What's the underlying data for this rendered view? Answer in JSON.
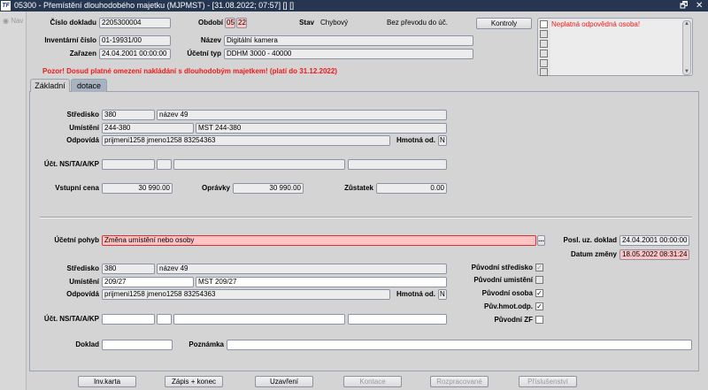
{
  "window": {
    "title": "05300 - Přemístění dlouhodobého majetku (MJPMST) - [31.08.2022; 07:57] [] []",
    "logo": "TF",
    "restore": "🗗",
    "close": "✕"
  },
  "sidebar": {
    "nav_label": "Nav"
  },
  "header": {
    "cislo_dokladu_label": "Číslo dokladu",
    "cislo_dokladu": "2205300004",
    "obdobi_label": "Období",
    "obdobi_month": "05",
    "obdobi_year": "22",
    "stav_label": "Stav",
    "stav": "Chybový",
    "bez_prevodu": "Bez převodu do úč.",
    "kontroly_label": "Kontroly",
    "inventarni_cislo_label": "Inventární číslo",
    "inventarni_cislo": "01-19931/00",
    "nazev_label": "Název",
    "nazev": "Digitální kamera",
    "zarazen_label": "Zařazen",
    "zarazen": "24.04.2001 00:00:00",
    "ucetni_typ_label": "Účetní typ",
    "ucetni_typ": "DDHM 3000 - 40000",
    "warning": "Pozor! Dosud platné omezení nakládání s dlouhodobým majetkem! (platí do 31.12.2022)",
    "messages": [
      "Neplatná odpovědná osoba!"
    ]
  },
  "tabs": [
    {
      "label": "Základní",
      "active": true
    },
    {
      "label": "dotace",
      "active": false
    }
  ],
  "current": {
    "stredisko_label": "Středisko",
    "stredisko": "380",
    "stredisko_nazev": "název 49",
    "umisteni_label": "Umístění",
    "umisteni": "244-380",
    "umisteni_nazev": "MST 244-380",
    "odpovida_label": "Odpovídá",
    "odpovida": "prijmeni1258 jmeno1258 83254363",
    "hmotna_label": "Hmotná od.",
    "hmotna": "N",
    "uct_label": "Účt. NS/TA/A/KP",
    "vstupni_cena_label": "Vstupní cena",
    "vstupni_cena": "30 990.00",
    "opravky_label": "Oprávky",
    "opravky": "30 990.00",
    "zustatek_label": "Zůstatek",
    "zustatek": "0.00"
  },
  "change": {
    "ucetni_pohyb_label": "Účetní pohyb",
    "ucetni_pohyb": "Změna umístění nebo osoby",
    "lookup": "...",
    "posl_doklad_label": "Posl. uz. doklad",
    "posl_doklad": "24.04.2001 00:00:00",
    "datum_zmeny_label": "Datum změny",
    "datum_zmeny": "18.05.2022 08:31:24",
    "stredisko_label": "Středisko",
    "stredisko": "380",
    "stredisko_nazev": "název 49",
    "umisteni_label": "Umístění",
    "umisteni": "209/27",
    "umisteni_nazev": "MST 209/27",
    "odpovida_label": "Odpovídá",
    "odpovida": "prijmeni1258 jmeno1258 83254363",
    "hmotna_label": "Hmotná od.",
    "hmotna": "N",
    "uct_label": "Účt. NS/TA/A/KP",
    "doklad_label": "Doklad",
    "poznamka_label": "Poznámka",
    "checks": [
      {
        "label": "Původní středisko",
        "checked": true,
        "disabled": true
      },
      {
        "label": "Původní umistění",
        "checked": false,
        "disabled": true
      },
      {
        "label": "Původní osoba",
        "checked": true,
        "disabled": false
      },
      {
        "label": "Pův.hmot.odp.",
        "checked": true,
        "disabled": false
      },
      {
        "label": "Původní ZF",
        "checked": false,
        "disabled": false
      }
    ]
  },
  "buttons": [
    {
      "label": "Inv.karta",
      "enabled": true
    },
    {
      "label": "Zápis + konec",
      "enabled": true
    },
    {
      "label": "Uzavření",
      "enabled": true
    },
    {
      "label": "Kontace",
      "enabled": false
    },
    {
      "label": "Rozpracované",
      "enabled": false
    },
    {
      "label": "Příslušenství",
      "enabled": false
    }
  ]
}
